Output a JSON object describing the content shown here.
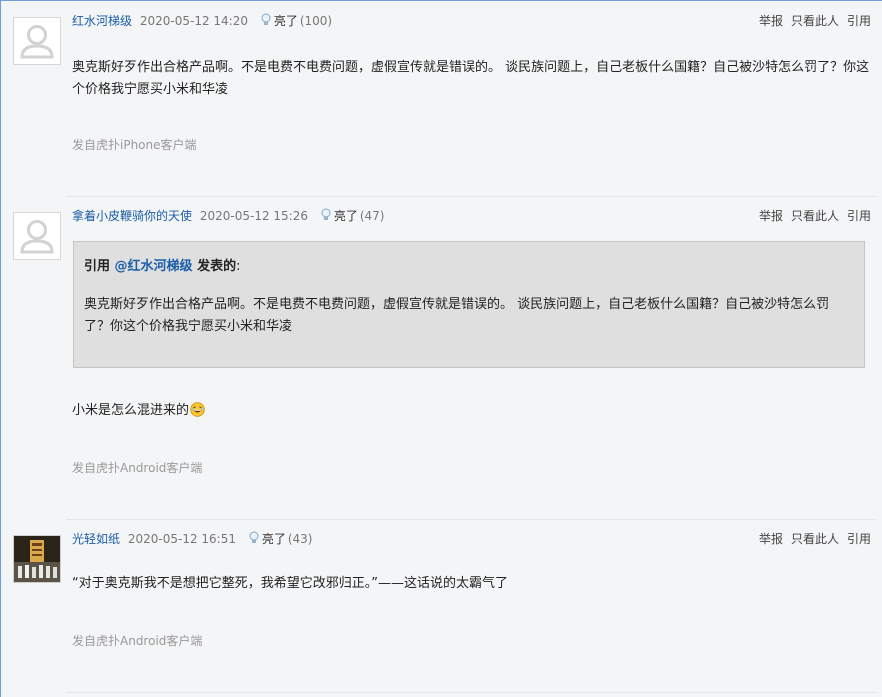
{
  "actions": {
    "report": "举报",
    "only_this": "只看此人",
    "quote": "引用"
  },
  "posts": [
    {
      "username": "红水河梯级",
      "time": "2020-05-12 14:20",
      "light_label": "亮了",
      "light_count": "(100)",
      "content": "奥克斯好歹作出合格产品啊。不是电费不电费问题，虚假宣传就是错误的。 谈民族问题上，自己老板什么国籍？自己被沙特怎么罚了？你这个价格我宁愿买小米和华凌",
      "device": "发自虎扑iPhone客户端"
    },
    {
      "username": "拿着小皮鞭骑你的天使",
      "time": "2020-05-12 15:26",
      "light_label": "亮了",
      "light_count": "(47)",
      "quote": {
        "prefix": "引用 ",
        "at_user": "@红水河梯级",
        "suffix": " 发表的",
        "colon": ":",
        "body": "奥克斯好歹作出合格产品啊。不是电费不电费问题，虚假宣传就是错误的。 谈民族问题上，自己老板什么国籍？自己被沙特怎么罚了？你这个价格我宁愿买小米和华凌"
      },
      "content": "小米是怎么混进来的",
      "emoji": "laughing-emoji",
      "device": "发自虎扑Android客户端"
    },
    {
      "username": "光轻如纸",
      "time": "2020-05-12 16:51",
      "light_label": "亮了",
      "light_count": "(43)",
      "content": "“对于奥克斯我不是想把它整死，我希望它改邪归正。”——这话说的太霸气了",
      "device": "发自虎扑Android客户端"
    }
  ],
  "colors": {
    "username": "#1a5ea8",
    "background": "#f4f5f7",
    "quote_bg": "#dfdfdf"
  }
}
